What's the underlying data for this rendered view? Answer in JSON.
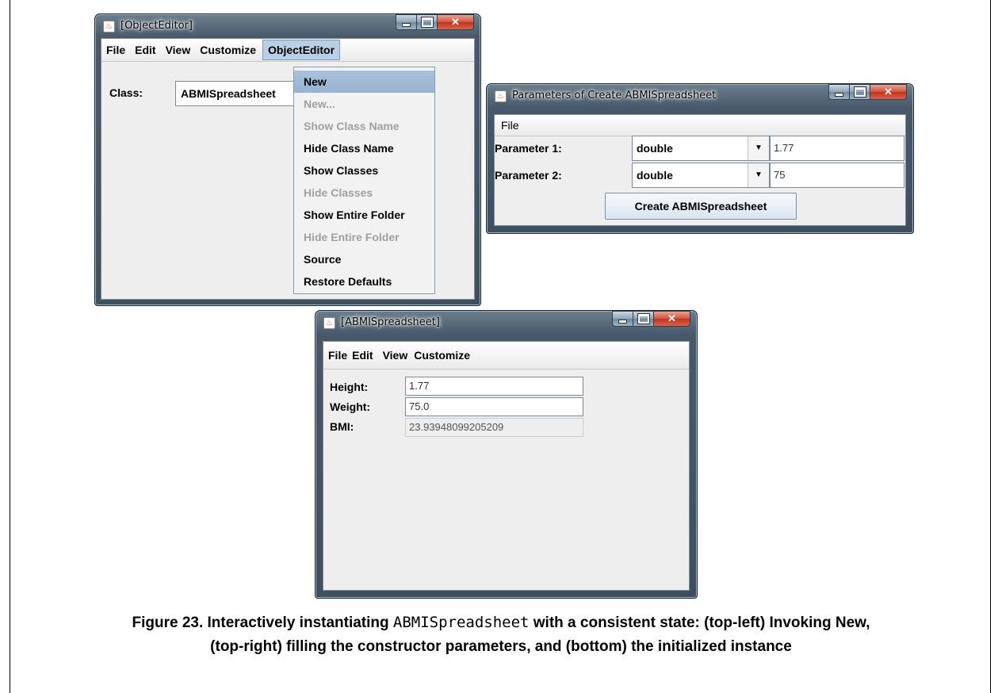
{
  "window1": {
    "title": "[ObjectEditor]",
    "menu": [
      "File",
      "Edit",
      "View",
      "Customize",
      "ObjectEditor"
    ],
    "class_label": "Class:",
    "class_value": "ABMISpreadsheet",
    "dropdown": [
      {
        "label": "New",
        "state": "selected"
      },
      {
        "label": "New...",
        "state": "disabled"
      },
      {
        "label": "Show Class Name",
        "state": "disabled"
      },
      {
        "label": "Hide Class Name",
        "state": "enabled"
      },
      {
        "label": "Show Classes",
        "state": "enabled"
      },
      {
        "label": "Hide Classes",
        "state": "disabled"
      },
      {
        "label": "Show Entire Folder",
        "state": "enabled"
      },
      {
        "label": "Hide Entire Folder",
        "state": "disabled"
      },
      {
        "label": "Source",
        "state": "enabled"
      },
      {
        "label": "Restore Defaults",
        "state": "enabled"
      }
    ]
  },
  "window2": {
    "title": "Parameters of Create  ABMISpreadsheet",
    "menu": [
      "File"
    ],
    "param1_label": "Parameter 1:",
    "param1_type": "double",
    "param1_value": "1.77",
    "param2_label": "Parameter 2:",
    "param2_type": "double",
    "param2_value": "75",
    "create_button": "Create  ABMISpreadsheet"
  },
  "window3": {
    "title": "[ABMISpreadsheet]",
    "menu": [
      "File",
      "Edit",
      "View",
      "Customize"
    ],
    "height_label": "Height:",
    "height_value": "1.77",
    "weight_label": "Weight:",
    "weight_value": "75.0",
    "bmi_label": "BMI:",
    "bmi_value": "23.93948099205209"
  },
  "caption": {
    "prefix": "Figure 23. Interactively instantiating ",
    "code": "ABMISpreadsheet",
    "line1_suffix": " with a consistent state: (top-left) Invoking New,",
    "line2": "(top-right) filling the constructor parameters, and (bottom) the initialized instance"
  },
  "colors": {
    "selected_menu": "#98b3d2",
    "disabled_text": "#a0a0a0",
    "window_frame": "#47586a"
  },
  "icons": [
    "java-icon",
    "minimize-icon",
    "maximize-icon",
    "close-icon",
    "dropdown-arrow-icon"
  ]
}
